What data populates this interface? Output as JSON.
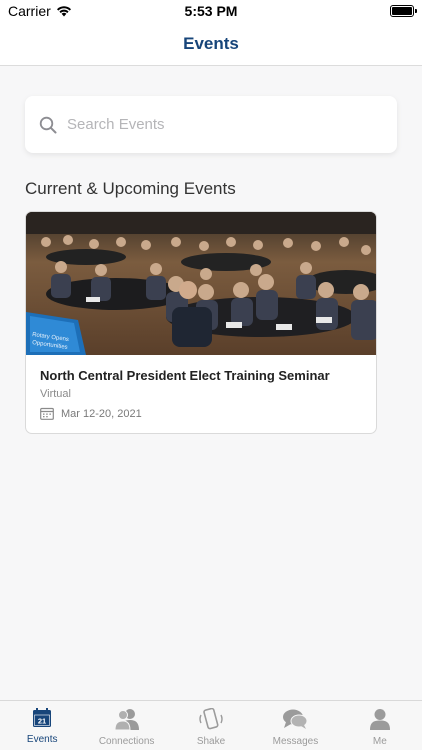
{
  "status_bar": {
    "carrier": "Carrier",
    "time": "5:53 PM"
  },
  "nav": {
    "title": "Events"
  },
  "search": {
    "placeholder": "Search Events",
    "value": ""
  },
  "section": {
    "title": "Current & Upcoming Events"
  },
  "events": [
    {
      "name": "North Central President Elect Training Seminar",
      "location": "Virtual",
      "date": "Mar 12-20, 2021"
    }
  ],
  "tab_bar": {
    "tabs": [
      {
        "label": "Events",
        "icon": "calendar-icon",
        "badge": "21",
        "active": true
      },
      {
        "label": "Connections",
        "icon": "people-icon",
        "active": false
      },
      {
        "label": "Shake",
        "icon": "shake-phone-icon",
        "active": false
      },
      {
        "label": "Messages",
        "icon": "chat-bubbles-icon",
        "active": false
      },
      {
        "label": "Me",
        "icon": "person-icon",
        "active": false
      }
    ]
  },
  "colors": {
    "brand": "#17457a",
    "inactive": "#9b9b9b",
    "background": "#f7f7f8"
  }
}
